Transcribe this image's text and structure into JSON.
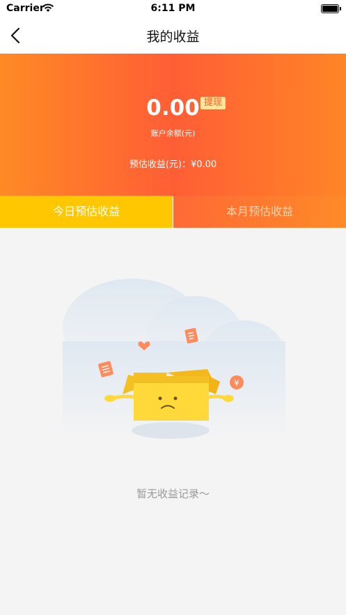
{
  "status_bar": {
    "carrier": "Carrier",
    "time": "6:11 PM"
  },
  "nav": {
    "title": "我的收益",
    "back_icon": "chevron-left-icon"
  },
  "hero": {
    "balance": "0.00",
    "withdraw_label": "提现",
    "balance_label": "账户余额(元)",
    "estimate_text": "预估收益(元)：¥0.00"
  },
  "tabs": [
    {
      "label": "今日预估收益",
      "selected": true
    },
    {
      "label": "本月预估收益",
      "selected": false
    }
  ],
  "empty": {
    "message": "暂无收益记录～"
  },
  "colors": {
    "accent_orange": "#ff6a35",
    "tab_yellow": "#ffc700",
    "withdraw_bg": "#ffe49a"
  }
}
